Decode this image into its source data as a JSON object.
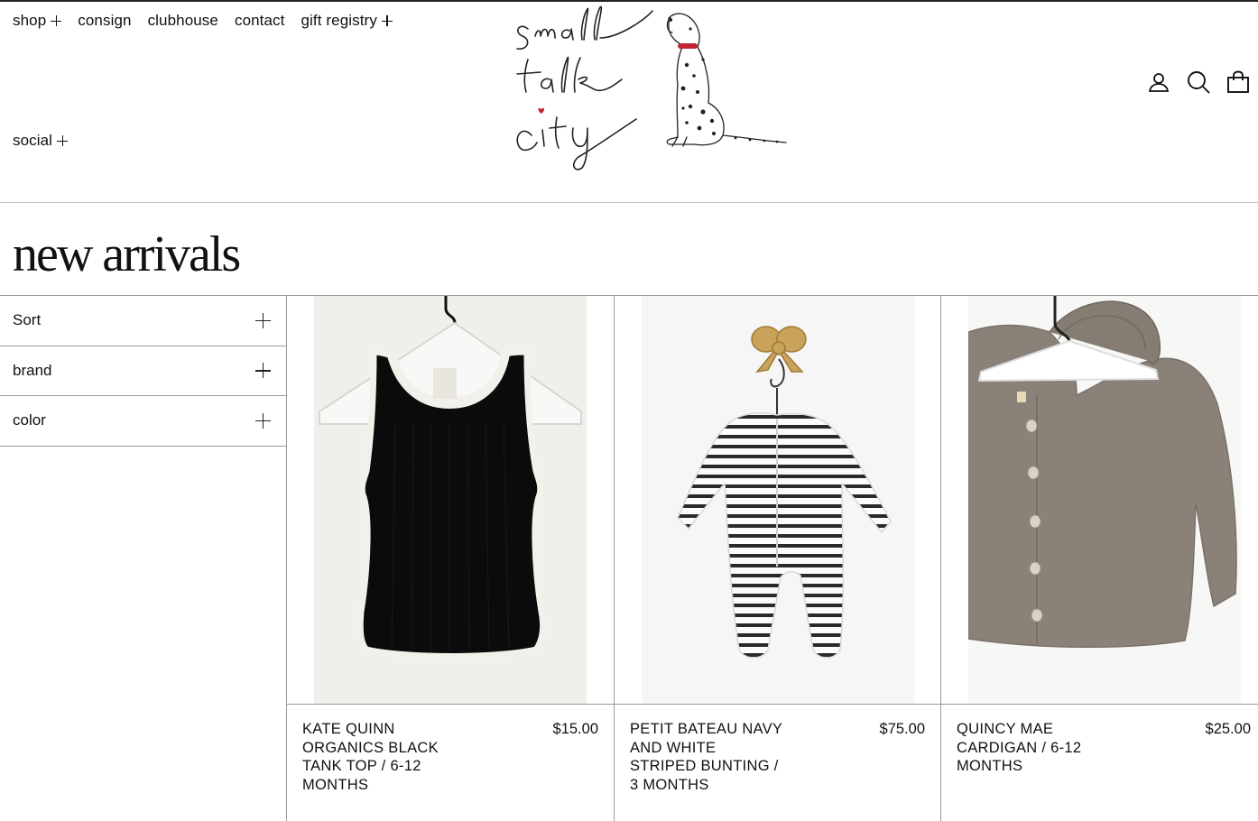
{
  "header": {
    "nav": [
      {
        "label": "shop",
        "expandable": true
      },
      {
        "label": "consign",
        "expandable": false
      },
      {
        "label": "clubhouse",
        "expandable": false
      },
      {
        "label": "contact",
        "expandable": false
      },
      {
        "label": "gift registry",
        "expandable": true
      }
    ],
    "social": {
      "label": "social",
      "expandable": true
    },
    "logo_text": [
      "small",
      "talk",
      "city"
    ],
    "icons": [
      "account-icon",
      "search-icon",
      "cart-icon"
    ]
  },
  "page": {
    "title": "new arrivals"
  },
  "filters": [
    {
      "label": "Sort"
    },
    {
      "label": "brand"
    },
    {
      "label": "color"
    }
  ],
  "products": [
    {
      "name": "KATE QUINN ORGANICS BLACK TANK TOP / 6-12 MONTHS",
      "price": "$15.00"
    },
    {
      "name": "PETIT BATEAU NAVY AND WHITE STRIPED BUNTING / 3 MONTHS",
      "price": "$75.00"
    },
    {
      "name": "QUINCY MAE CARDIGAN / 6-12 MONTHS",
      "price": "$25.00"
    }
  ],
  "colors": {
    "text": "#111111",
    "rule": "#9a9a9a",
    "collar_red": "#c0262d",
    "cardigan": "#8a8178"
  }
}
